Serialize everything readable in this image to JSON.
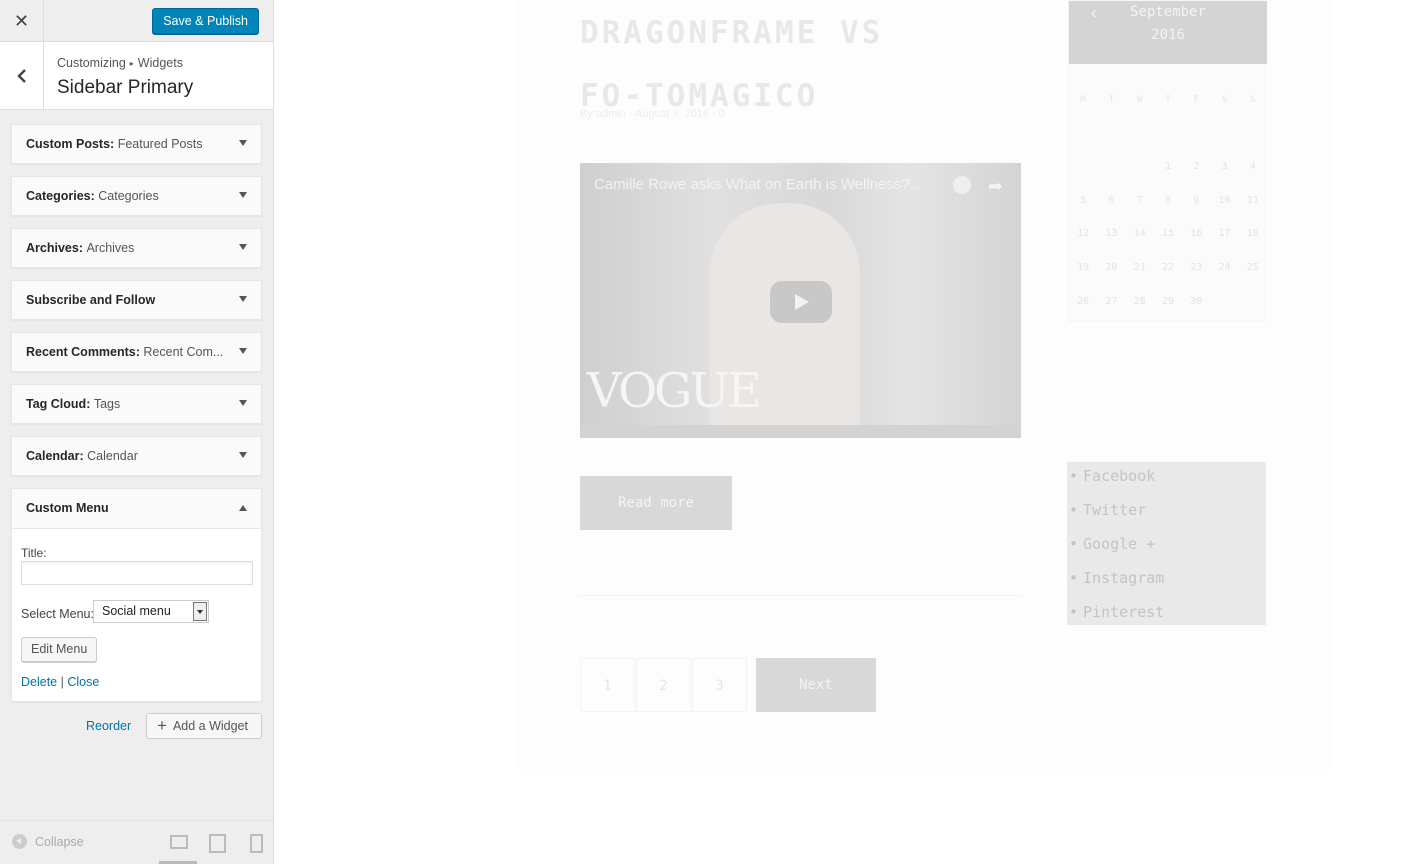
{
  "topbar": {
    "close_label": "✕",
    "save_label": "Save & Publish"
  },
  "section": {
    "breadcrumb_root": "Customizing",
    "breadcrumb_sep": "▸",
    "breadcrumb_leaf": "Widgets",
    "title": "Sidebar Primary"
  },
  "widgets": [
    {
      "type": "Custom Posts",
      "name": "Featured Posts"
    },
    {
      "type": "Categories",
      "name": "Categories"
    },
    {
      "type": "Archives",
      "name": "Archives"
    },
    {
      "type": "Subscribe and Follow",
      "name": ""
    },
    {
      "type": "Recent Comments",
      "name": "Recent Com..."
    },
    {
      "type": "Tag Cloud",
      "name": "Tags"
    },
    {
      "type": "Calendar",
      "name": "Calendar"
    }
  ],
  "custom_menu": {
    "type": "Custom Menu",
    "title_label": "Title:",
    "title_value": "",
    "select_label": "Select Menu:",
    "selected_menu": "Social menu",
    "edit_label": "Edit Menu",
    "delete_label": "Delete",
    "separator": "|",
    "close_label": "Close"
  },
  "panel_actions": {
    "reorder_label": "Reorder",
    "add_label": "Add a Widget"
  },
  "footer": {
    "collapse_label": "Collapse"
  },
  "colors": {
    "primary_button": "#0085ba",
    "link": "#0073aa"
  },
  "preview": {
    "post_title": "DRAGONFRAME VS FO-TOMAGICO",
    "post_meta": "By admin - August 9, 2016 - 0",
    "video": {
      "title": "Camille Rowe asks What on Earth is Wellness?...",
      "brand": "VOGUE",
      "share_icon": "share-icon",
      "watch_later_icon": "clock-icon"
    },
    "read_more": "Read more",
    "pagination": [
      "1",
      "2",
      "3"
    ],
    "next_label": "Next",
    "calendar": {
      "month": "September",
      "year": "2016",
      "weekdays": [
        "M",
        "T",
        "W",
        "T",
        "F",
        "S",
        "S"
      ],
      "weeks": [
        [
          "",
          "",
          "",
          "1",
          "2",
          "3",
          "4"
        ],
        [
          "5",
          "6",
          "7",
          "8",
          "9",
          "10",
          "11"
        ],
        [
          "12",
          "13",
          "14",
          "15",
          "16",
          "17",
          "18"
        ],
        [
          "19",
          "20",
          "21",
          "22",
          "23",
          "24",
          "25"
        ],
        [
          "26",
          "27",
          "28",
          "29",
          "30",
          "",
          ""
        ]
      ]
    },
    "social_links": [
      "Facebook",
      "Twitter",
      "Google +",
      "Instagram",
      "Pinterest"
    ]
  }
}
